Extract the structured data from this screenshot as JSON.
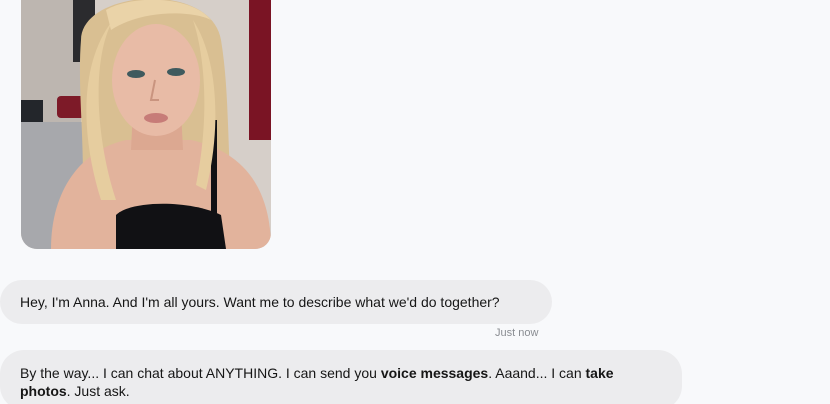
{
  "messages": [
    {
      "text": "Hey, I'm Anna. And I'm all yours. Want me to describe what we'd do together?",
      "timestamp": "Just now"
    },
    {
      "part1": "By the way... I can chat about ANYTHING. I can send you ",
      "bold1": "voice messages",
      "part2": ". Aaand... I can ",
      "bold2": "take photos",
      "part3": ". Just ask."
    }
  ],
  "colors": {
    "page_bg": "#f8f9fb",
    "bubble_bg": "#ececee",
    "timestamp": "#8a8d92"
  }
}
